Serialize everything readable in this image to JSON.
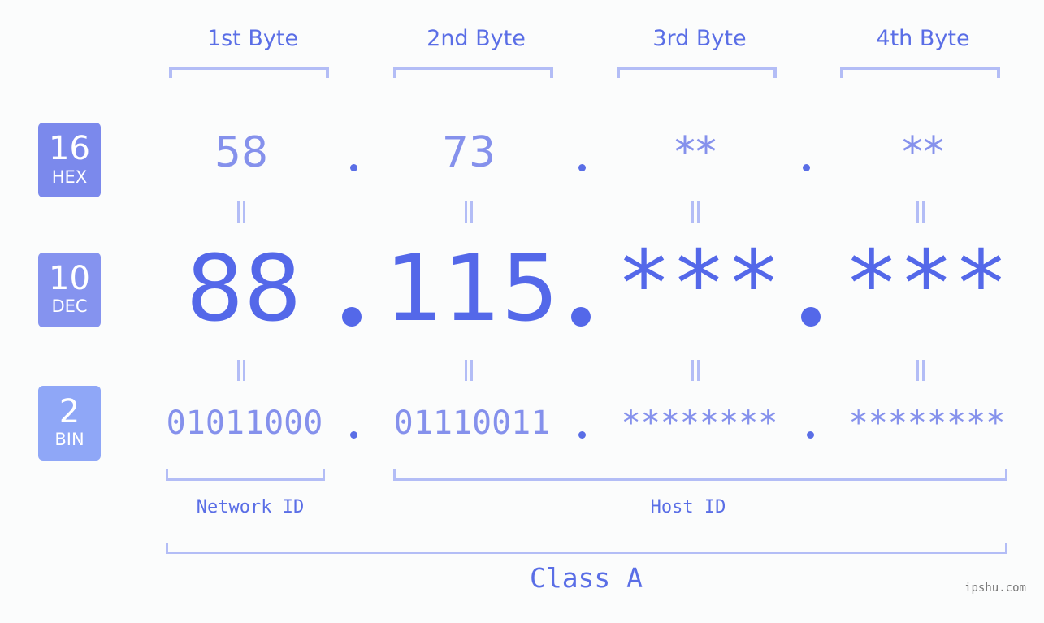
{
  "bytes": [
    {
      "title": "1st Byte",
      "hex": "58",
      "dec": "88",
      "bin": "01011000"
    },
    {
      "title": "2nd Byte",
      "hex": "73",
      "dec": "115",
      "bin": "01110011"
    },
    {
      "title": "3rd Byte",
      "hex": "**",
      "dec": "***",
      "bin": "********"
    },
    {
      "title": "4th Byte",
      "hex": "**",
      "dec": "***",
      "bin": "********"
    }
  ],
  "badges": {
    "hex": {
      "num": "16",
      "label": "HEX",
      "color": "#7b89ec"
    },
    "dec": {
      "num": "10",
      "label": "DEC",
      "color": "#8593ef"
    },
    "bin": {
      "num": "2",
      "label": "BIN",
      "color": "#8fa7f7"
    }
  },
  "labels": {
    "network_id": "Network ID",
    "host_id": "Host ID",
    "class": "Class A"
  },
  "watermark": "ipshu.com",
  "colors": {
    "accent": "#5468e9",
    "light_accent": "#8591ec",
    "bracket": "#b3bdf6"
  }
}
